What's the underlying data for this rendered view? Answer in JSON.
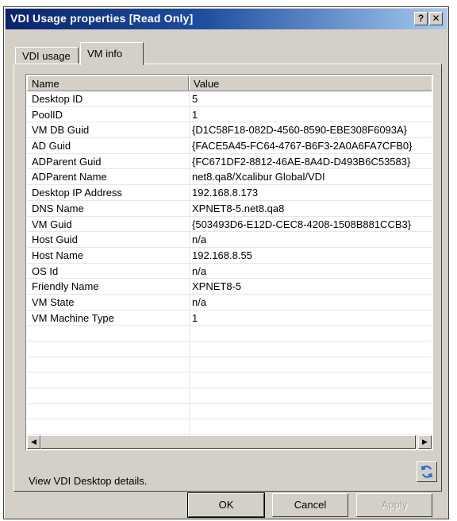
{
  "window": {
    "title": "VDI Usage properties [Read Only]",
    "help_label": "?",
    "close_label": "✕"
  },
  "tabs": [
    {
      "label": "VDI usage",
      "active": false
    },
    {
      "label": "VM info",
      "active": true
    }
  ],
  "grid": {
    "columns": [
      "Name",
      "Value"
    ],
    "rows": [
      {
        "name": "Desktop ID",
        "value": "5"
      },
      {
        "name": "PoolID",
        "value": "1"
      },
      {
        "name": "VM DB Guid",
        "value": "{D1C58F18-082D-4560-8590-EBE308F6093A}"
      },
      {
        "name": "AD Guid",
        "value": "{FACE5A45-FC64-4767-B6F3-2A0A6FA7CFB0}"
      },
      {
        "name": "ADParent Guid",
        "value": "{FC671DF2-8812-46AE-8A4D-D493B6C53583}"
      },
      {
        "name": "ADParent Name",
        "value": "net8.qa8/Xcalibur Global/VDI"
      },
      {
        "name": "Desktop IP Address",
        "value": "192.168.8.173"
      },
      {
        "name": "DNS Name",
        "value": "XPNET8-5.net8.qa8"
      },
      {
        "name": "VM Guid",
        "value": "{503493D6-E12D-CEC8-4208-1508B881CCB3}"
      },
      {
        "name": "Host Guid",
        "value": "n/a"
      },
      {
        "name": "Host Name",
        "value": "192.168.8.55"
      },
      {
        "name": "OS Id",
        "value": "n/a"
      },
      {
        "name": "Friendly Name",
        "value": "XPNET8-5"
      },
      {
        "name": "VM State",
        "value": "n/a"
      },
      {
        "name": "VM Machine Type",
        "value": "1"
      }
    ]
  },
  "description": "View VDI Desktop details.",
  "buttons": {
    "ok": "OK",
    "cancel": "Cancel",
    "apply": "Apply"
  },
  "colors": {
    "titlebar_start": "#0a246a",
    "titlebar_end": "#a6caf0",
    "dialog_bg": "#d4d0c8"
  },
  "icons": {
    "refresh": "refresh-icon"
  }
}
